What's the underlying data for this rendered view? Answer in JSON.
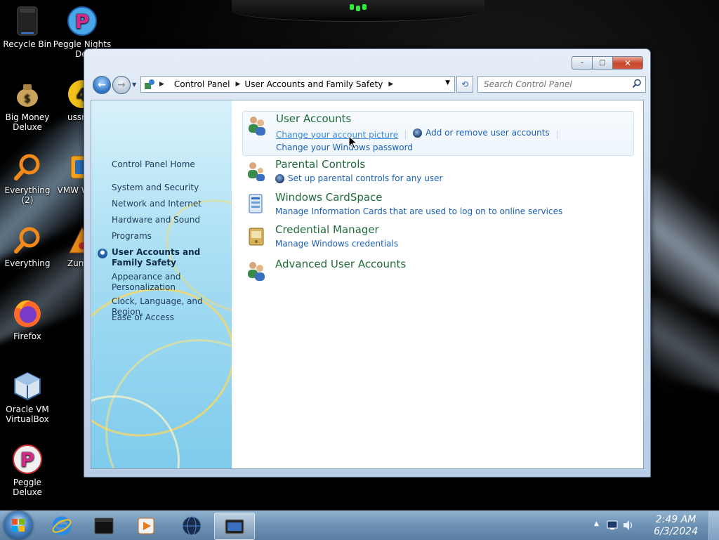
{
  "desktop": {
    "icons": [
      {
        "label": "Recycle Bin"
      },
      {
        "label": "Peggle Nights Deluxe",
        "visible_label": "Peggle Nights Del"
      },
      {
        "label": "Big Money Deluxe"
      },
      {
        "label": "ussr wi"
      },
      {
        "label": "Everything (2)"
      },
      {
        "label": "VMW Works"
      },
      {
        "label": "Everything"
      },
      {
        "label": "Zuma I"
      },
      {
        "label": "Firefox"
      },
      {
        "label": "Oracle VM VirtualBox"
      },
      {
        "label": "Peggle Deluxe"
      }
    ]
  },
  "window": {
    "caption_buttons": {
      "minimize": "–",
      "maximize": "□",
      "close": "✕"
    },
    "address": {
      "crumbs": [
        "Control Panel",
        "User Accounts and Family Safety"
      ]
    },
    "search": {
      "placeholder": "Search Control Panel"
    },
    "left_pane": {
      "home": "Control Panel Home",
      "links": [
        "System and Security",
        "Network and Internet",
        "Hardware and Sound",
        "Programs",
        "User Accounts and Family Safety",
        "Appearance and Personalization",
        "Clock, Language, and Region",
        "Ease of Access"
      ],
      "current_index": 4
    },
    "categories": [
      {
        "title": "User Accounts",
        "tasks": [
          "Change your account picture",
          "Add or remove user accounts",
          "Change your Windows password"
        ]
      },
      {
        "title": "Parental Controls",
        "tasks": [
          "Set up parental controls for any user"
        ]
      },
      {
        "title": "Windows CardSpace",
        "tasks": [
          "Manage Information Cards that are used to log on to online services"
        ]
      },
      {
        "title": "Credential Manager",
        "tasks": [
          "Manage Windows credentials"
        ]
      },
      {
        "title": "Advanced User Accounts",
        "tasks": []
      }
    ]
  },
  "taskbar": {
    "clock": {
      "time": "2:49 AM",
      "date": "6/3/2024"
    },
    "pinned": [
      "windows-explorer",
      "internet-explorer",
      "command-prompt",
      "media-player",
      "globe-app",
      "control-panel"
    ]
  },
  "colors": {
    "category_title": "#1f6b3a",
    "task_link": "#1a5fb4",
    "taskbar": "#6f93b5",
    "left_pane": "#a6ddf3"
  }
}
